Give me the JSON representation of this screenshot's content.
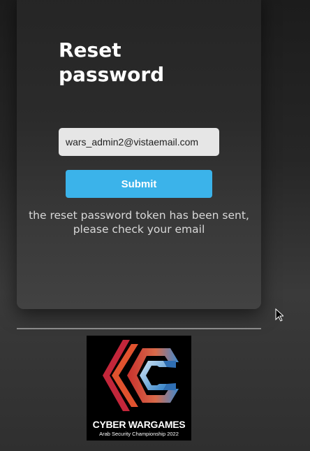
{
  "form": {
    "title": "Reset password",
    "email_value": "wars_admin2@vistaemail.com",
    "submit_label": "Submit",
    "status_message": "the reset password token has been sent, please check your email"
  },
  "logo": {
    "title": "CYBER WARGAMES",
    "subtitle": "Arab Security Championship 2022"
  },
  "colors": {
    "accent": "#3bb3ea",
    "card": "#2b2b2b",
    "input": "#e6e6e6"
  }
}
